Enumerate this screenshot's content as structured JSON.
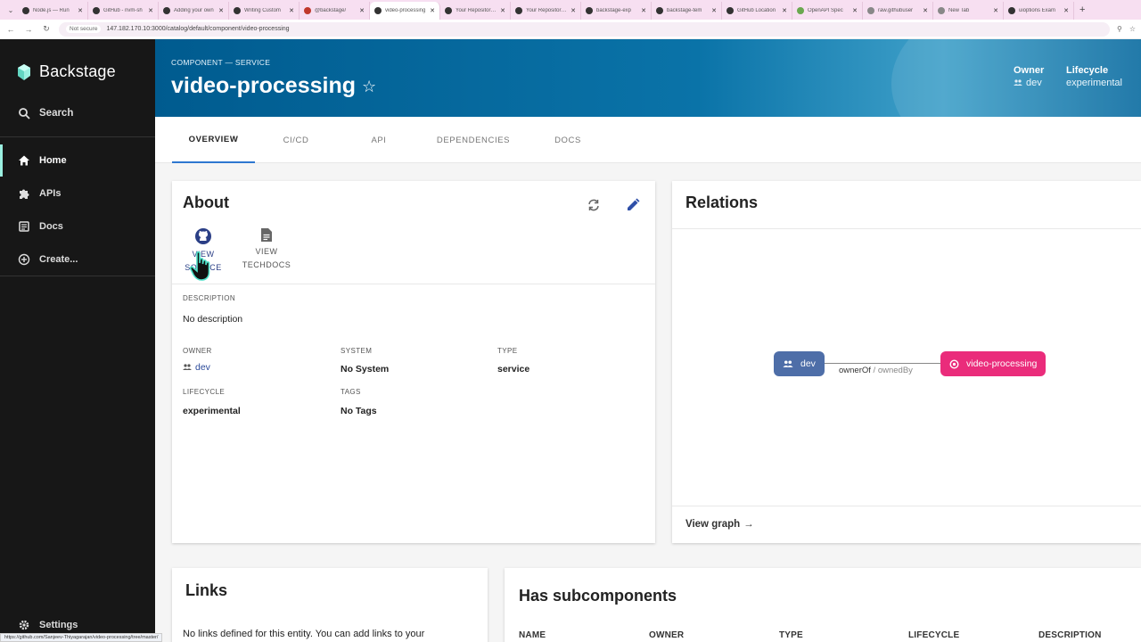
{
  "browser": {
    "tabs": [
      {
        "title": "Node.js — Run",
        "active": false
      },
      {
        "title": "GitHub - nvm-sh",
        "active": false
      },
      {
        "title": "Adding your own",
        "active": false
      },
      {
        "title": "Writing Custom",
        "active": false
      },
      {
        "title": "@backstage/",
        "active": false
      },
      {
        "title": "video-processing",
        "active": true
      },
      {
        "title": "Your Repositories",
        "active": false
      },
      {
        "title": "Your Repositories",
        "active": false
      },
      {
        "title": "backstage-exp",
        "active": false
      },
      {
        "title": "backstage-tem",
        "active": false
      },
      {
        "title": "GitHub Location",
        "active": false
      },
      {
        "title": "OpenAPI Spec",
        "active": false
      },
      {
        "title": "raw.githubuser",
        "active": false
      },
      {
        "title": "New Tab",
        "active": false
      },
      {
        "title": "uioptions Exam",
        "active": false
      }
    ],
    "security_label": "Not secure",
    "url": "147.182.170.10:3000/catalog/default/component/video-processing",
    "status_url": "https://github.com/Sanjeev-Thiyagarajan/video-processing/tree/master/"
  },
  "sidebar": {
    "logo": "Backstage",
    "search": "Search",
    "items": [
      {
        "label": "Home",
        "icon": "home-icon",
        "active": true
      },
      {
        "label": "APIs",
        "icon": "puzzle-icon",
        "active": false
      },
      {
        "label": "Docs",
        "icon": "docs-icon",
        "active": false
      },
      {
        "label": "Create...",
        "icon": "add-circle-icon",
        "active": false
      }
    ],
    "settings": "Settings"
  },
  "header": {
    "kind": "COMPONENT — SERVICE",
    "title": "video-processing",
    "owner_label": "Owner",
    "owner_value": "dev",
    "lifecycle_label": "Lifecycle",
    "lifecycle_value": "experimental"
  },
  "tabs": [
    "OVERVIEW",
    "CI/CD",
    "API",
    "DEPENDENCIES",
    "DOCS"
  ],
  "about": {
    "title": "About",
    "view_source_1": "VIEW",
    "view_source_2": "SOURCE",
    "view_techdocs_1": "VIEW",
    "view_techdocs_2": "TECHDOCS",
    "description_label": "DESCRIPTION",
    "description": "No description",
    "owner_label": "OWNER",
    "owner": "dev",
    "system_label": "SYSTEM",
    "system": "No System",
    "type_label": "TYPE",
    "type": "service",
    "lifecycle_label": "LIFECYCLE",
    "lifecycle": "experimental",
    "tags_label": "TAGS",
    "tags": "No Tags"
  },
  "relations": {
    "title": "Relations",
    "source_node": "dev",
    "target_node": "video-processing",
    "edge_label_a": "ownerOf",
    "edge_label_sep": " / ",
    "edge_label_b": "ownedBy",
    "view_graph": "View graph"
  },
  "links": {
    "title": "Links",
    "empty_text": "No links defined for this entity. You can add links to your"
  },
  "subcomponents": {
    "title": "Has subcomponents",
    "columns": [
      "NAME",
      "OWNER",
      "TYPE",
      "LIFECYCLE",
      "DESCRIPTION"
    ]
  },
  "colors": {
    "sidebar_bg": "#171717",
    "accent": "#9BF0E1",
    "header_blue": "#005b8f",
    "relation_owner_node": "#4e6ea8",
    "relation_component_node": "#ea2c7b",
    "tab_indicator": "#2e77d0"
  }
}
